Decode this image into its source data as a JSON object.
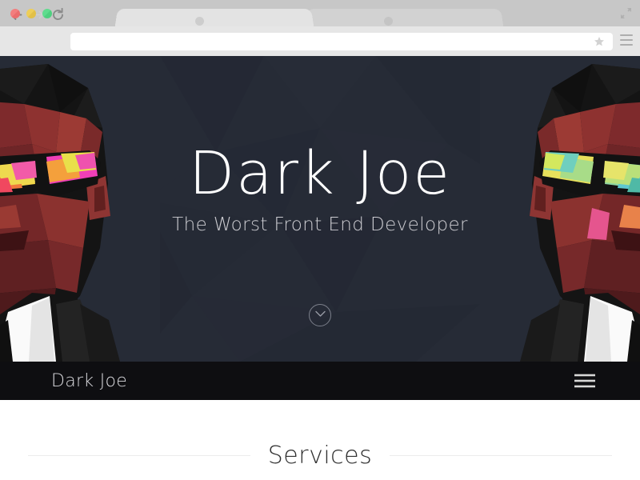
{
  "browser": {
    "window_controls": [
      {
        "name": "close",
        "color": "#ee6d6d"
      },
      {
        "name": "minimize",
        "color": "#e8c84f"
      },
      {
        "name": "maximize",
        "color": "#55d586"
      }
    ],
    "tabs": [
      {
        "title": "",
        "active": true
      },
      {
        "title": "",
        "active": false
      }
    ],
    "toolbar": {
      "back_icon": "back-arrow-icon",
      "forward_icon": "forward-arrow-icon",
      "reload_icon": "reload-icon",
      "bookmark_icon": "star-icon",
      "menu_icon": "hamburger-menu-icon",
      "expand_icon": "fullscreen-expand-icon"
    },
    "address_bar": {
      "value": "",
      "placeholder": ""
    }
  },
  "page": {
    "hero": {
      "title": "Dark Joe",
      "subtitle": "The Worst Front End Developer",
      "scroll_indicator_icon": "chevron-down-icon",
      "background_color": "#262b36"
    },
    "nav": {
      "brand": "Dark Joe",
      "toggle_icon": "hamburger-menu-icon",
      "background_color": "#0e0e11"
    },
    "services": {
      "title": "Services",
      "rule_color": "#ececec"
    }
  }
}
